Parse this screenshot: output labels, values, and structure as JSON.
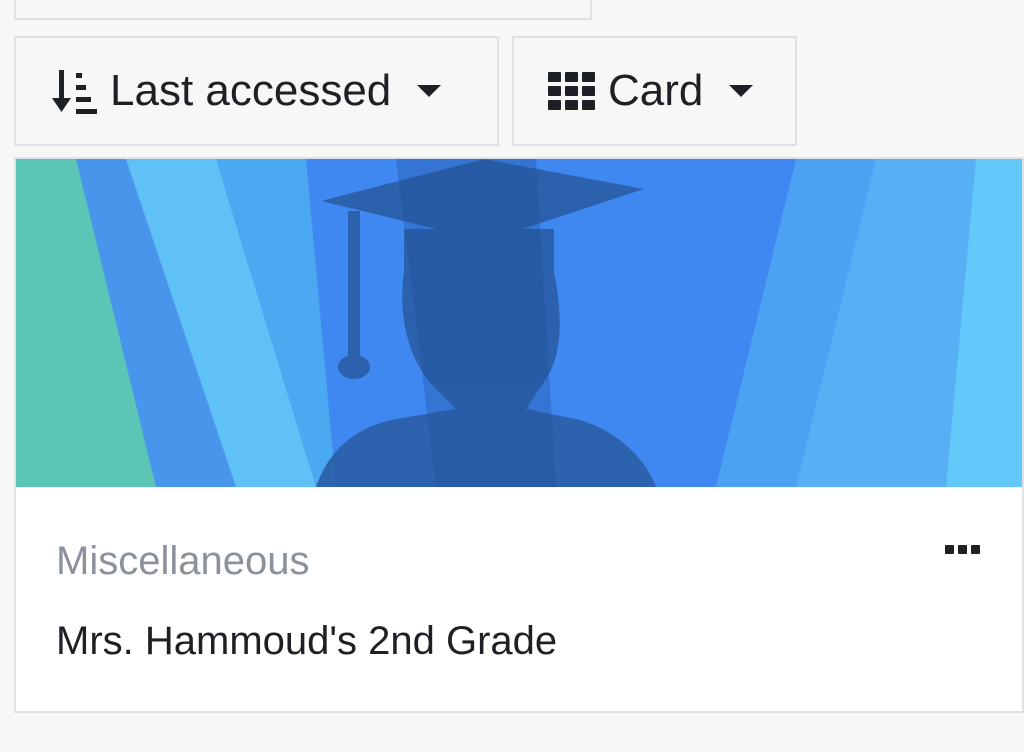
{
  "toolbar": {
    "sort": {
      "label": "Last accessed",
      "icon": "sort-amount-icon"
    },
    "view": {
      "label": "Card",
      "icon": "grid-icon"
    }
  },
  "course_card": {
    "category": "Miscellaneous",
    "name": "Mrs. Hammoud's 2nd Grade",
    "image": "graduate-silhouette-banner",
    "menu_icon": "ellipsis-icon"
  },
  "colors": {
    "page_background": "#f7f7f8",
    "border": "#dee2e6",
    "text": "#1d2125",
    "muted_text": "#8b9299",
    "banner_blue": "#4287f5",
    "banner_teal": "#5ac8b8",
    "silhouette": "#2f5aa0"
  }
}
